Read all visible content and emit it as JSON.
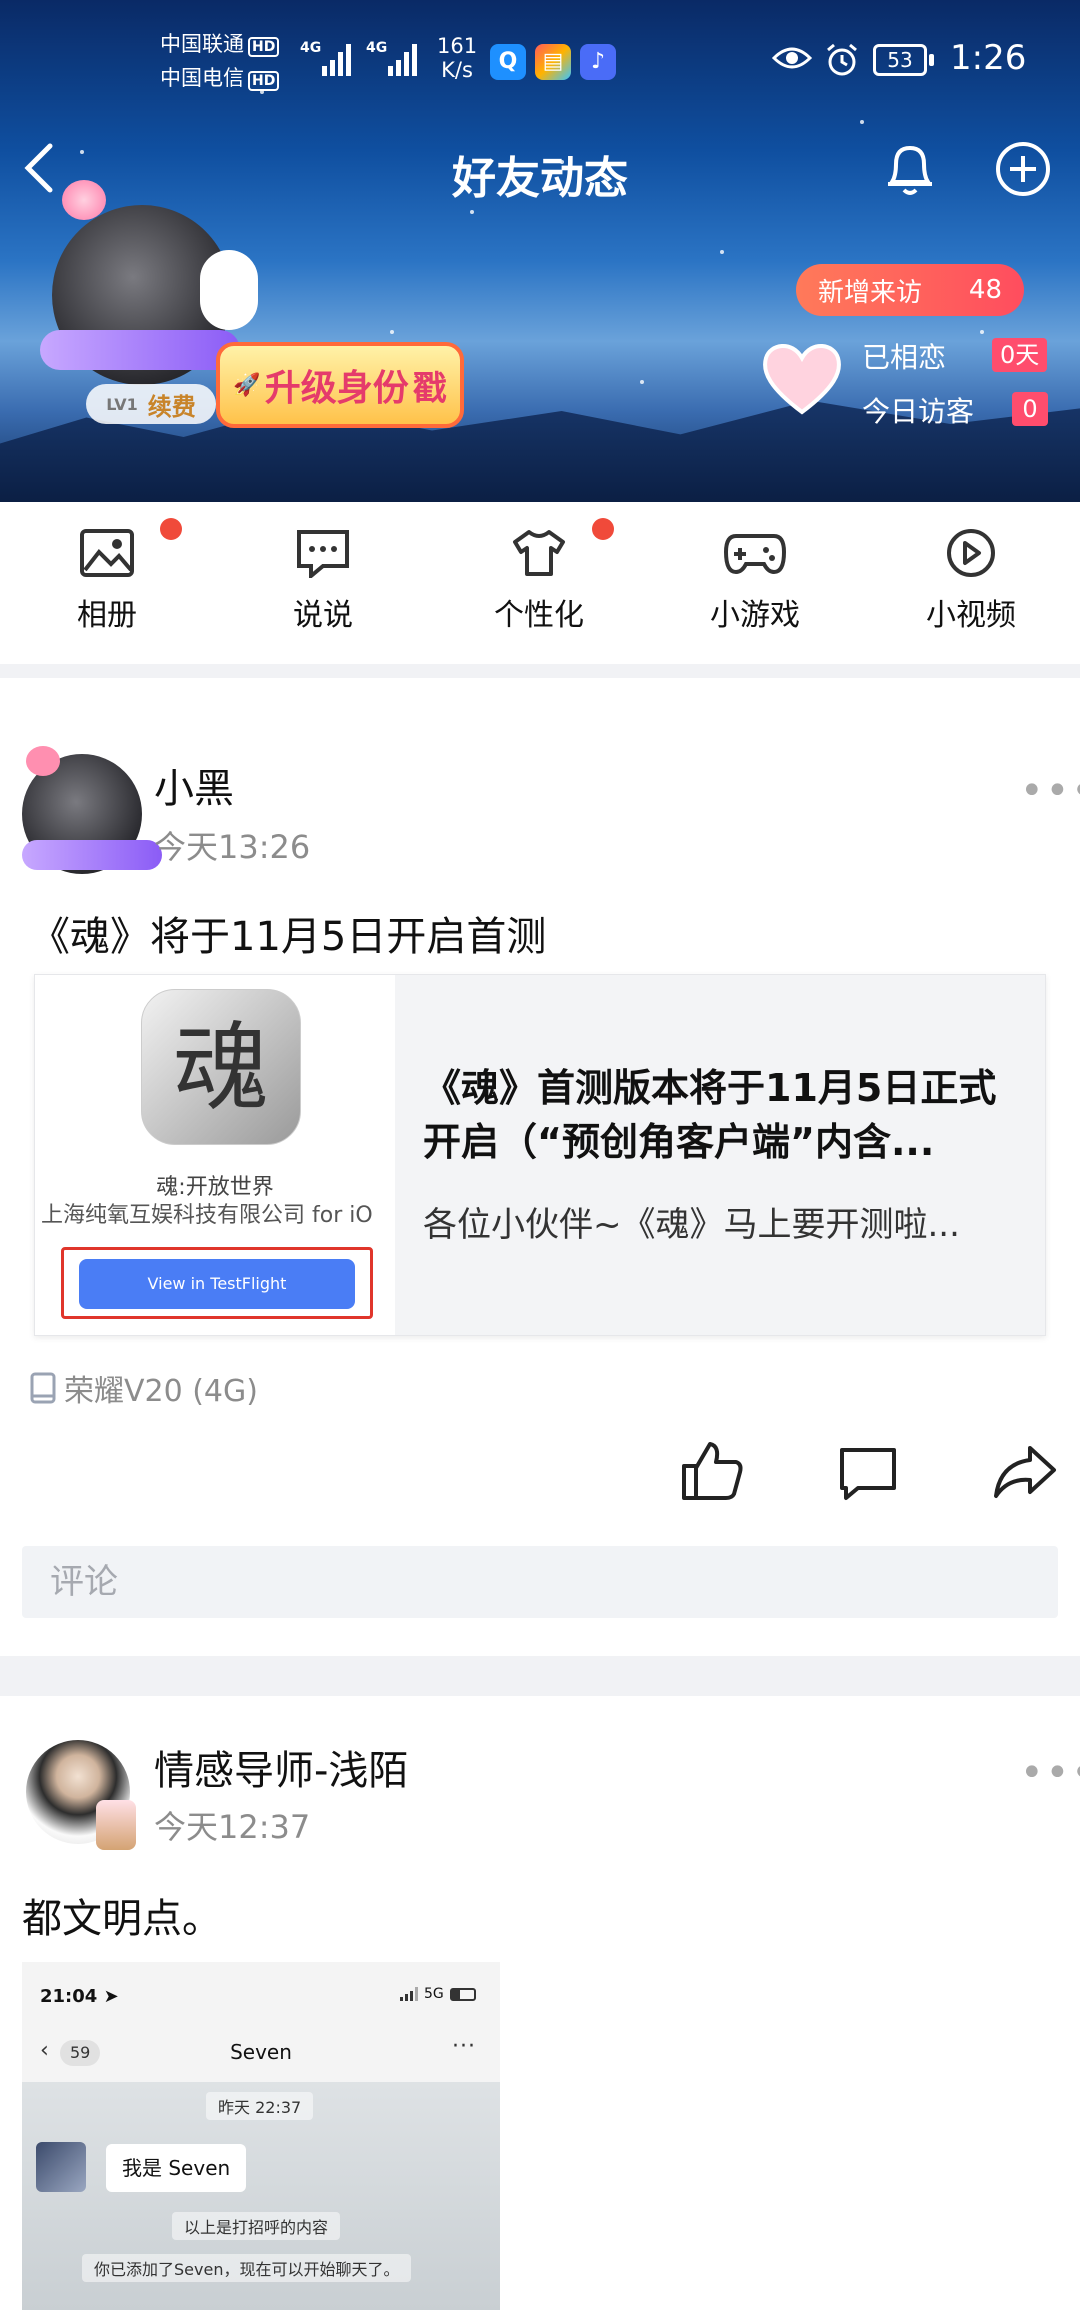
{
  "status_bar": {
    "carrier1": "中国联通",
    "carrier2": "中国电信",
    "hd": "HD",
    "net1": "4G",
    "net2": "4G",
    "speed_value": "161",
    "speed_unit": "K/s",
    "battery": "53",
    "time": "1:26",
    "app_icons": [
      "qq-browser-icon",
      "toolbox-icon",
      "music-icon"
    ]
  },
  "header": {
    "title": "好友动态",
    "back_icon": "back-arrow-icon",
    "bell_icon": "bell-icon",
    "add_icon": "plus-circle-icon"
  },
  "profile": {
    "level": "LV1",
    "renew_label": "续费",
    "upgrade_label": "升级身份",
    "upgrade_badge": "戳",
    "new_visits_label": "新增来访",
    "new_visits_count": "48",
    "together_label": "已相恋",
    "together_value": "0天",
    "visitors_label": "今日访客",
    "visitors_value": "0"
  },
  "tabs": [
    {
      "label": "相册",
      "icon": "image-icon",
      "has_dot": true
    },
    {
      "label": "说说",
      "icon": "chat-bubble-icon",
      "has_dot": false
    },
    {
      "label": "个性化",
      "icon": "tshirt-icon",
      "has_dot": true
    },
    {
      "label": "小游戏",
      "icon": "gamepad-icon",
      "has_dot": false
    },
    {
      "label": "小视频",
      "icon": "play-circle-icon",
      "has_dot": false
    }
  ],
  "post1": {
    "author": "小黑",
    "time": "今天13:26",
    "text": "《魂》将于11月5日开启首测",
    "share_card": {
      "app_glyph": "魂",
      "app_name": "魂:开放世界",
      "developer": "上海纯氧互娱科技有限公司 for iO",
      "button_label": "View in TestFlight",
      "title": "《魂》首测版本将于11月5日正式开启（“预创角客户端”内含...",
      "desc": "各位小伙伴~《魂》马上要开测啦..."
    },
    "device": "荣耀V20 (4G)",
    "comment_placeholder": "评论"
  },
  "post2": {
    "author": "情感导师-浅陌",
    "time": "今天12:37",
    "text": "都文明点。",
    "screenshot": {
      "time": "21:04",
      "network": "5G",
      "back_count": "59",
      "contact": "Seven",
      "date": "昨天 22:37",
      "message": "我是 Seven",
      "notice1": "以上是打招呼的内容",
      "notice2": "你已添加了Seven，现在可以开始聊天了。"
    }
  }
}
